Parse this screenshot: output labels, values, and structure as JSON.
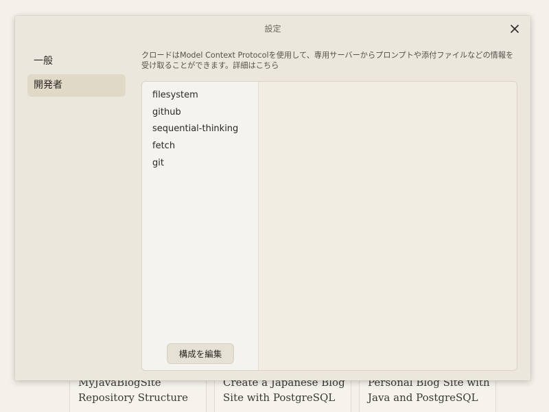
{
  "background": {
    "cards": [
      {
        "lines": [
          "MyJavaBlogSite",
          "Repository Structure"
        ]
      },
      {
        "lines": [
          "Create a Japanese Blog",
          "Site with PostgreSQL"
        ]
      },
      {
        "lines": [
          "Personal Blog Site with",
          "Java and PostgreSQL"
        ]
      }
    ]
  },
  "dialog": {
    "title": "設定",
    "close_icon": "close-icon"
  },
  "nav": {
    "items": [
      {
        "label": "一般",
        "active": false
      },
      {
        "label": "開発者",
        "active": true
      }
    ]
  },
  "developer": {
    "description_prefix": "クロードはModel Context Protocolを使用して、専用サーバーからプロンプトや添付ファイルなどの情報を受け取ることができます。",
    "description_link": "詳細はこちら",
    "servers": [
      "filesystem",
      "github",
      "sequential-thinking",
      "fetch",
      "git"
    ],
    "edit_config_label": "構成を編集"
  },
  "colors": {
    "page_bg": "#f4f1ea",
    "modal_bg": "#ece7dc",
    "active_nav_bg": "#e0d9c7",
    "list_bg": "#f5f3ee"
  }
}
